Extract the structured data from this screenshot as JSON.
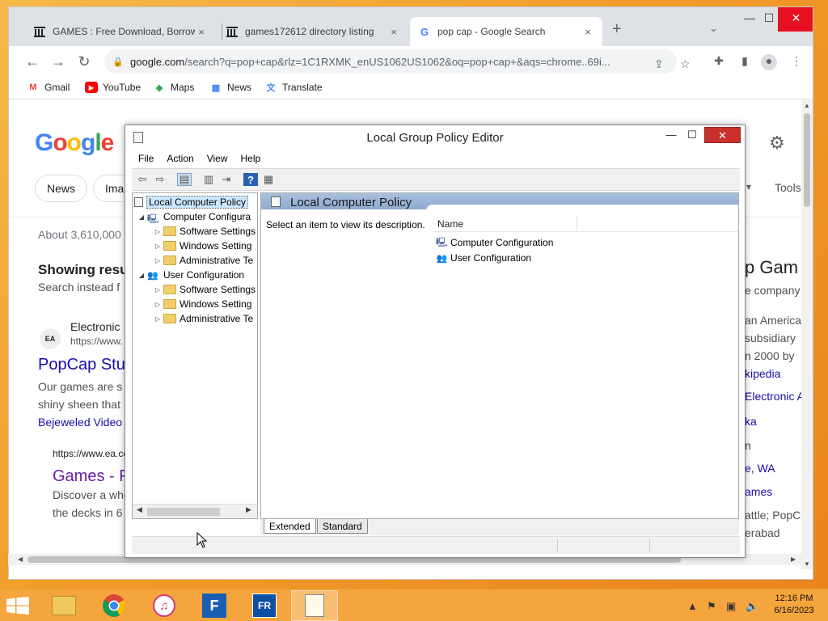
{
  "browser": {
    "tabs": [
      {
        "title": "GAMES : Free Download, Borrow",
        "close": "×"
      },
      {
        "title": "games172612 directory listing",
        "close": "×"
      },
      {
        "title": "pop cap - Google Search",
        "close": "×"
      }
    ],
    "new_tab": "+",
    "tab_search": "⌄",
    "window_controls": {
      "minimize": "—",
      "maximize": "☐",
      "close": "✕"
    },
    "url_domain": "google.com",
    "url_path": "/search?q=pop+cap&rlz=1C1RXMK_enUS1062US1062&oq=pop+cap+&aqs=chrome..69i...",
    "bookmarks": [
      "Gmail",
      "YouTube",
      "Maps",
      "News",
      "Translate"
    ]
  },
  "google": {
    "logo": "Google",
    "chips": [
      "News",
      "Ima"
    ],
    "tools": "Tools",
    "results_count": "About 3,610,000",
    "showing": "Showing resu",
    "search_instead": "Search instead f",
    "ea_site": "Electronic",
    "ea_url": "https://www.",
    "popcap_link": "PopCap Stu",
    "snippet1": "Our games are s",
    "snippet2": "shiny sheen that",
    "bejeweled": "Bejeweled Video",
    "ea_url2": "https://www.ea.co",
    "games_link": "Games - P",
    "snippet3": "Discover a whe",
    "snippet4": "the decks in 6",
    "kp": [
      "p Gam",
      "e company",
      "an America",
      "subsidiary",
      "n 2000 by",
      "kipedia",
      "Electronic A",
      "ka",
      "n",
      "e, WA",
      "ames",
      "attle; PopC",
      "erabad"
    ]
  },
  "gpe": {
    "title": "Local Group Policy Editor",
    "menu": [
      "File",
      "Action",
      "View",
      "Help"
    ],
    "tree": {
      "root": "Local Computer Policy",
      "computer": "Computer Configura",
      "user": "User Configuration",
      "children": [
        "Software Settings",
        "Windows Setting",
        "Administrative Te"
      ]
    },
    "header": "Local Computer Policy",
    "description": "Select an item to view its description.",
    "column_name": "Name",
    "items": [
      "Computer Configuration",
      "User Configuration"
    ],
    "view_tabs": [
      "Extended",
      "Standard"
    ]
  },
  "taskbar": {
    "time": "12:16 PM",
    "date": "6/16/2023"
  }
}
